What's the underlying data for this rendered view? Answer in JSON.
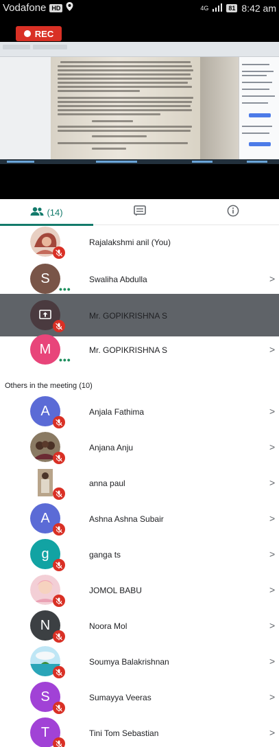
{
  "status_bar": {
    "carrier": "Vodafone",
    "carrier_badge": "HD",
    "signal": "4G",
    "battery": "81",
    "time": "8:42 am"
  },
  "recording": {
    "label": "REC"
  },
  "tabs": {
    "people_count": "(14)"
  },
  "participants": [
    {
      "name": "Rajalakshmi anil (You)",
      "avatar": "photo",
      "muted": true
    },
    {
      "name": "Swaliha Abdulla",
      "avatar": "S",
      "color": "#795548",
      "speaking_dots": "•••"
    },
    {
      "name": "Mr. GOPIKRISHNA S",
      "avatar": "present-screen-icon",
      "presenting": true,
      "muted": true
    },
    {
      "name": "Mr. GOPIKRISHNA S",
      "avatar": "M",
      "color": "#e8457a",
      "speaking_dots": "•••"
    }
  ],
  "others_label": "Others in the meeting (10)",
  "others": [
    {
      "name": "Anjala Fathima",
      "avatar": "A",
      "color": "#5b6bd6",
      "muted": true
    },
    {
      "name": "Anjana Anju",
      "avatar": "photo",
      "muted": true
    },
    {
      "name": "anna paul",
      "avatar": "photo",
      "muted": true
    },
    {
      "name": "Ashna Ashna Subair",
      "avatar": "A",
      "color": "#5b6bd6",
      "muted": true
    },
    {
      "name": "ganga ts",
      "avatar": "g",
      "color": "#12a3a3",
      "muted": true
    },
    {
      "name": "JOMOL BABU",
      "avatar": "photo",
      "muted": true
    },
    {
      "name": "Noora Mol",
      "avatar": "N",
      "color": "#3c4043",
      "muted": true
    },
    {
      "name": "Soumya Balakrishnan",
      "avatar": "photo",
      "muted": true
    },
    {
      "name": "Sumayya Veeras",
      "avatar": "S",
      "color": "#a142d6",
      "muted": true
    },
    {
      "name": "Tini Tom Sebastian",
      "avatar": "T",
      "color": "#a142d6",
      "muted": true
    }
  ],
  "colors": {
    "accent": "#137a6b",
    "mute_red": "#d93025",
    "rec_red": "#d93025"
  }
}
